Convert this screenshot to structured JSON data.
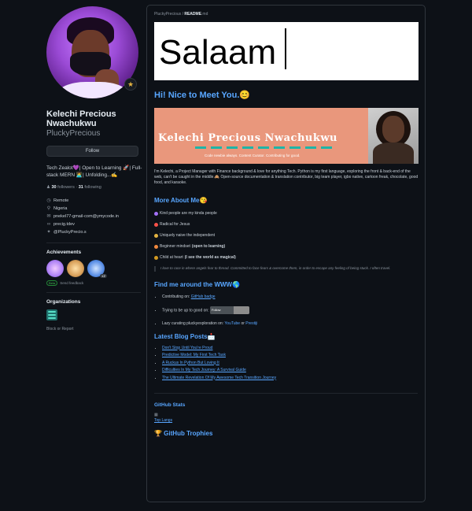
{
  "profile": {
    "full_name_line1": "Kelechi Precious",
    "full_name_line2": "Nwachukwu",
    "username": "PluckyPrecious",
    "follow_label": "Follow",
    "status_emoji": "★",
    "bio": "Tech Zealot💜| Open to Learning 🚀| Full-stack MERN 👩‍💻| Unfolding...✍",
    "followers_count": "30",
    "followers_label": "followers",
    "following_count": "31",
    "following_label": "following",
    "details": [
      {
        "icon": "clock-icon",
        "text": "Remote"
      },
      {
        "icon": "location-icon",
        "text": "Nigeria"
      },
      {
        "icon": "mail-icon",
        "text": "pnekel77-gmail-com@ymycode.in"
      },
      {
        "icon": "link-icon",
        "text": "precig.tdev"
      },
      {
        "icon": "twitter-icon",
        "text": "@PluckyPrecio.s"
      }
    ],
    "achievements_heading": "Achievements",
    "achievement_multiplier": "x2",
    "beta_label": "Beta",
    "send_feedback": "Send feedback",
    "organizations_heading": "Organizations",
    "block_report": "Block or Report"
  },
  "readme": {
    "path_owner": "PluckyPrecious",
    "path_sep": " / ",
    "path_file": "README",
    "path_ext": ".md",
    "salaam": "Salaam",
    "hello_heading": "Hi! Nice to Meet You.😊",
    "banner_title": "Kelechi Precious Nwachukwu",
    "banner_subtitle": "Code newbie always. Content Curator. Contributing for good.",
    "intro": "I'm Kelechi, a Project Manager with Finance background & love for anything Tech. Python is my first language, exploring the front & back-end of the web, can't be caught in the middle.🙈 Open-source documentation & translation contributor, big team player, igbo native, cartoon freak, chocolate, good food, and karaoke.",
    "more_heading": "More About Me😘",
    "more_items": [
      {
        "color": "#a371f7",
        "text": "Kind people are my kinda people",
        "strong": ""
      },
      {
        "color": "#f85149",
        "text": "Radical for Jesus",
        "strong": ""
      },
      {
        "color": "#e3b341",
        "text": "Uniquely naive the independent",
        "strong": ""
      },
      {
        "color": "#f0883e",
        "text": "Beginner mindset ",
        "strong": "(open to learning)"
      },
      {
        "color": "#d29922",
        "text": "Child at heart ",
        "strong": "(I see the world as magical)"
      }
    ],
    "quote": "I love to race in where angels fear to thread. Committed to face fears & overcome them, in order to escape any feeling of being stuck. I often travel.",
    "find_heading": "Find me around the WWW🌎",
    "find_items": [
      {
        "text": "Contributing on: ",
        "link": "GitHub badge"
      },
      {
        "text": "Trying to be up to good on: ",
        "badge_label": "Follow"
      },
      {
        "text": "Lazy curating pluckyexploration on: ",
        "link": "YouTube",
        "mid": " or ",
        "link2": "Prestiji"
      }
    ],
    "blog_heading": "Latest Blog Posts📩",
    "blog_posts": [
      "Don't Stop Until You're Proud",
      "Predictive Model: My First Tech Task",
      "A Ruckus In Python But Loving It",
      "Difficulties In My Tech Journey: A Survival Guide",
      "The Ultimate Revelation Of My Awesome Tech Transition Journey"
    ],
    "stats_heading": "GitHub Stats",
    "top_langs_alt": "Top Langs",
    "trophies_heading": "🏆 GitHub Trophies"
  },
  "colors": {
    "background": "#0d1117",
    "link": "#58a6ff",
    "banner": "#e9977c",
    "banner_accent": "#1fb5a8"
  }
}
